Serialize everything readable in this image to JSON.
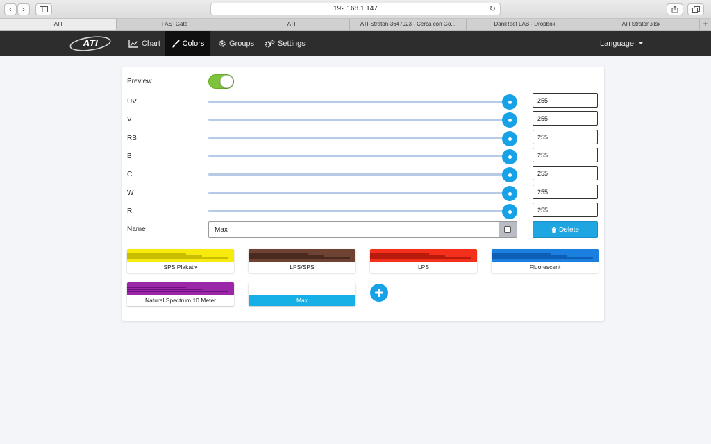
{
  "browser": {
    "url": "192.168.1.147",
    "tabs": [
      {
        "label": "ATI",
        "active": true
      },
      {
        "label": "FASTGate",
        "active": false
      },
      {
        "label": "ATI",
        "active": false
      },
      {
        "label": "ATI-Straton-3647923 - Cerca con Go...",
        "active": false
      },
      {
        "label": "DaniReef LAB - Dropbox",
        "active": false
      },
      {
        "label": "ATI Straton.xlsx",
        "active": false
      }
    ],
    "new_tab_label": "+"
  },
  "nav": {
    "logo": "ATI",
    "items": [
      {
        "label": "Chart",
        "icon": "chart-icon",
        "active": false
      },
      {
        "label": "Colors",
        "icon": "brush-icon",
        "active": true
      },
      {
        "label": "Groups",
        "icon": "gear-icon",
        "active": false
      },
      {
        "label": "Settings",
        "icon": "gears-icon",
        "active": false
      }
    ],
    "language_label": "Language"
  },
  "editor": {
    "preview_label": "Preview",
    "preview_on": true,
    "channels": [
      {
        "label": "UV",
        "value": "255",
        "level": 1.0
      },
      {
        "label": "V",
        "value": "255",
        "level": 1.0
      },
      {
        "label": "RB",
        "value": "255",
        "level": 1.0
      },
      {
        "label": "B",
        "value": "255",
        "level": 1.0
      },
      {
        "label": "C",
        "value": "255",
        "level": 1.0
      },
      {
        "label": "W",
        "value": "255",
        "level": 1.0
      },
      {
        "label": "R",
        "value": "255",
        "level": 1.0
      }
    ],
    "name_label": "Name",
    "name_value": "Max",
    "delete_label": "Delete"
  },
  "presets": [
    {
      "label": "SPS Plakativ",
      "color": "#f7ea0c",
      "dark": "#c9bd00",
      "selected": false
    },
    {
      "label": "LPS/SPS",
      "color": "#6f4334",
      "dark": "#4a2a1e",
      "selected": false
    },
    {
      "label": "LPS",
      "color": "#f42f1c",
      "dark": "#b81a0c",
      "selected": false
    },
    {
      "label": "Fluorescent",
      "color": "#1b7fe0",
      "dark": "#0c5fb4",
      "selected": false
    },
    {
      "label": "Natural Spectrum 10 Meter",
      "color": "#9a27a8",
      "dark": "#6e1080",
      "selected": false
    },
    {
      "label": "Max",
      "color": "#ffffff",
      "dark": "#eeeeee",
      "selected": true
    }
  ],
  "colors": {
    "accent": "#17a1e6",
    "toggle_on": "#7dc33b",
    "navbar": "#2d2d2d"
  }
}
